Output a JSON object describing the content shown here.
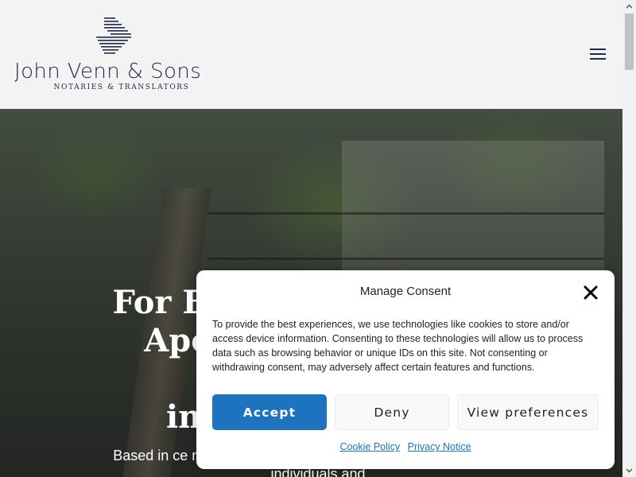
{
  "header": {
    "logo_name": "John Venn & Sons",
    "logo_tagline": "NOTARIES & TRANSLATORS",
    "menu_icon": "hamburger-menu-icon"
  },
  "hero": {
    "heading_line1": "For Excellen",
    "heading_line2": "Apostille a",
    "heading_line3": "in Lon",
    "subtext": "Based in ce                                                  n accredited firm offers swift and efficient services to individuals and"
  },
  "consent": {
    "title": "Manage Consent",
    "close_icon": "close-icon",
    "body": "To provide the best experiences, we use technologies like cookies to store and/or access device information. Consenting to these technologies will allow us to process data such as browsing behavior or unique IDs on this site. Not consenting or withdrawing consent, may adversely affect certain features and functions.",
    "accept_label": "Accept",
    "deny_label": "Deny",
    "preferences_label": "View preferences",
    "cookie_policy_link": "Cookie Policy",
    "privacy_notice_link": "Privacy Notice"
  },
  "colors": {
    "brand_navy": "#1f2a4a",
    "accept_blue": "#1e73be",
    "header_bg": "#f3f3f4"
  }
}
